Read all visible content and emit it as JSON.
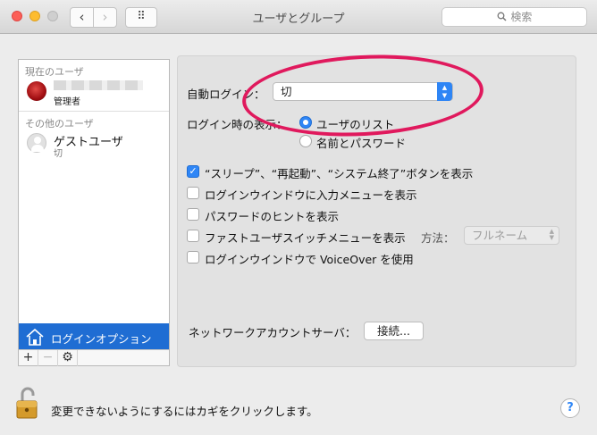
{
  "window": {
    "title": "ユーザとグループ"
  },
  "toolbar": {
    "back_glyph": "‹",
    "forward_glyph": "›",
    "grid_glyph": "⠿",
    "search_placeholder": "検索"
  },
  "sidebar": {
    "current_user_section": "現在のユーザ",
    "current_user": {
      "role": "管理者"
    },
    "other_users_section": "その他のユーザ",
    "guest_user": {
      "name": "ゲストユーザ",
      "status": "切"
    },
    "login_options_label": "ログインオプション",
    "add_glyph": "+",
    "remove_glyph": "−",
    "gear_glyph": "⚙"
  },
  "login_options": {
    "auto_login_label": "自動ログイン：",
    "auto_login_value": "切",
    "display_label": "ログイン時の表示：",
    "radio_user_list": "ユーザのリスト",
    "radio_name_password": "名前とパスワード",
    "selected_display": "user_list",
    "checkboxes": [
      {
        "label": "“スリープ”、“再起動”、“システム終了”ボタンを表示",
        "checked": true
      },
      {
        "label": "ログインウインドウに入力メニューを表示",
        "checked": false
      },
      {
        "label": "パスワードのヒントを表示",
        "checked": false
      },
      {
        "label": "ファストユーザスイッチメニューを表示",
        "checked": false
      },
      {
        "label": "ログインウインドウで VoiceOver を使用",
        "checked": false
      }
    ],
    "method_label": "方法：",
    "method_value": "フルネーム",
    "network_server_label": "ネットワークアカウントサーバ：",
    "connect_button": "接続..."
  },
  "footer": {
    "lock_text": "変更できないようにするにはカギをクリックします。",
    "help_glyph": "?"
  },
  "colors": {
    "accent": "#2f86f6",
    "selection": "#1f6dd3",
    "annotation": "#e0195d"
  }
}
